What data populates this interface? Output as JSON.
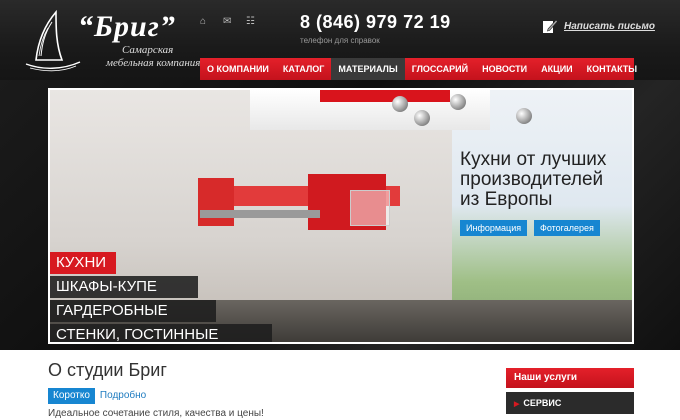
{
  "colors": {
    "accent": "#d71920",
    "link_blue": "#1786d1",
    "header_bg": "#1a1a1a"
  },
  "logo": {
    "title": "“Бриг”",
    "subtitle_line1": "Самарская",
    "subtitle_line2": "мебельная компания",
    "icon": "sailboat-icon"
  },
  "top_icons": [
    {
      "name": "home-icon",
      "glyph": "⌂"
    },
    {
      "name": "mail-icon",
      "glyph": "✉"
    },
    {
      "name": "sitemap-icon",
      "glyph": "☷"
    }
  ],
  "contact": {
    "phone": "8 (846) 979 72 19",
    "phone_hint": "телефон для справок",
    "write_label": "Написать письмо",
    "write_icon": "pencil-note-icon"
  },
  "nav": {
    "items": [
      "О КОМПАНИИ",
      "КАТАЛОГ",
      "МАТЕРИАЛЫ",
      "ГЛОССАРИЙ",
      "НОВОСТИ",
      "АКЦИИ",
      "КОНТАКТЫ"
    ],
    "active": "МАТЕРИАЛЫ"
  },
  "hero": {
    "title_line1": "Кухни от лучших",
    "title_line2": "производителей",
    "title_line3": "из Европы",
    "buttons": [
      "Информация",
      "Фотогалерея"
    ],
    "categories": [
      "КУХНИ",
      "ШКАФЫ-КУПЕ",
      "ГАРДЕРОБНЫЕ",
      "СТЕНКИ, ГОСТИННЫЕ"
    ]
  },
  "content": {
    "title": "О студии Бриг",
    "tabs": [
      "Коротко",
      "Подробно"
    ],
    "active_tab": "Коротко",
    "intro": "Идеальное сочетание стиля, качества и цены!"
  },
  "services": {
    "heading": "Наши услуги",
    "items": [
      "СЕРВИС"
    ]
  }
}
